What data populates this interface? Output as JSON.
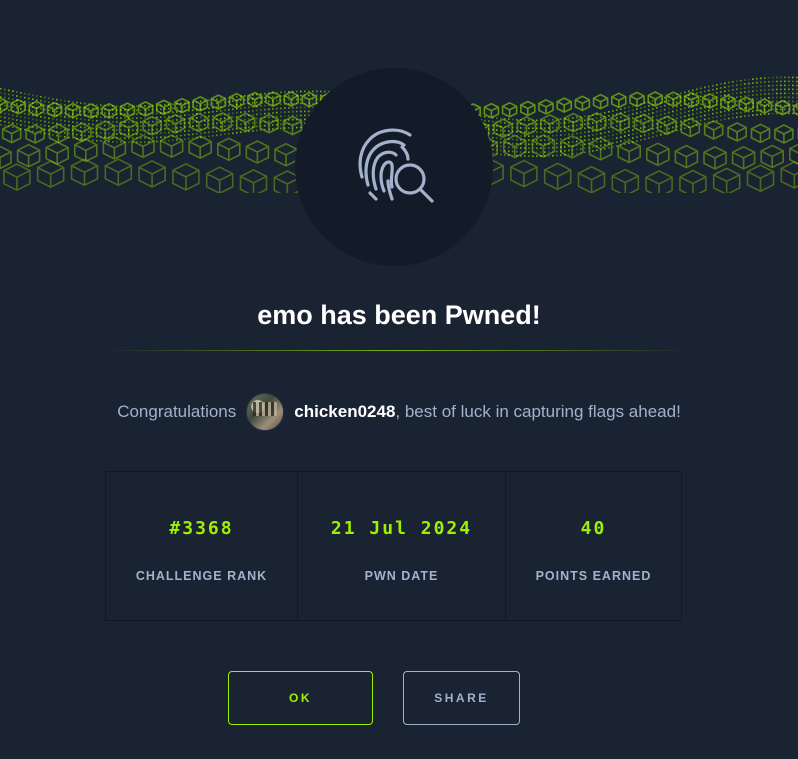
{
  "banner": {
    "pattern": "green-hex-cubes-wave",
    "accent_color": "#9fef00"
  },
  "emblem": {
    "icon": "fingerprint-search-icon"
  },
  "title": "emo has been Pwned!",
  "congrats": {
    "prefix": "Congratulations",
    "username": "chicken0248",
    "suffix": ", best of luck in capturing flags ahead!"
  },
  "stats": [
    {
      "value": "#3368",
      "label": "CHALLENGE RANK"
    },
    {
      "value": "21 Jul 2024",
      "label": "PWN DATE"
    },
    {
      "value": "40",
      "label": "POINTS EARNED"
    }
  ],
  "buttons": {
    "ok": "OK",
    "share": "SHARE"
  },
  "colors": {
    "background": "#1a2332",
    "accent": "#9fef00",
    "muted": "#a4b1cd"
  }
}
